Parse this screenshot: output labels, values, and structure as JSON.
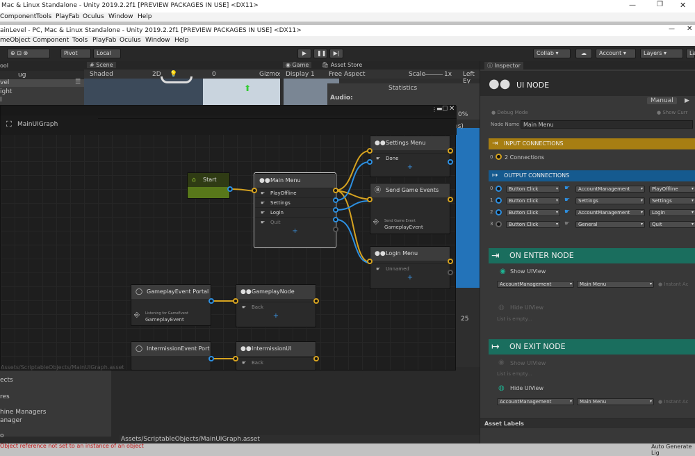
{
  "window": {
    "title": "Mac & Linux Standalone - Unity 2019.2.2f1 [PREVIEW PACKAGES IN USE] <DX11>",
    "menu": [
      "Component",
      "Tools",
      "PlayFab",
      "Oculus",
      "Window",
      "Help"
    ]
  },
  "inner_window": {
    "title": "ainLevel - PC, Mac & Linux Standalone - Unity 2019.2.2f1 [PREVIEW PACKAGES IN USE] <DX11>",
    "menu": [
      "meObject",
      "Component",
      "Tools",
      "PlayFab",
      "Oculus",
      "Window",
      "Help"
    ]
  },
  "toolbar": {
    "pivot": "Pivot",
    "local": "Local",
    "collab": "Collab ▾",
    "account": "Account",
    "layers": "Layers",
    "layout": "La"
  },
  "left_panel": {
    "tab": "ool",
    "search": "ug",
    "items": [
      "vel",
      "ight",
      "l"
    ]
  },
  "scene": {
    "tab": "Scene",
    "shading": "Shaded",
    "mode2d": "2D",
    "count": "0",
    "gizmos": "Gizmos"
  },
  "game": {
    "tab_game": "Game",
    "tab_store": "Asset Store",
    "display": "Display 1",
    "aspect": "Free Aspect",
    "scale_label": "Scale",
    "scale_value": "1x",
    "left_label": "Left Ey",
    "stats_title": "Statistics",
    "audio": "Audio:",
    "pct": "0%",
    "ns": "ns)",
    "count25": "25"
  },
  "graph": {
    "title": "MainUIGraph",
    "path": "Assets/ScriptableObjects/MainUIGraph.asset",
    "nodes": {
      "start": {
        "title": "Start"
      },
      "main_menu": {
        "title": "Main Menu",
        "rows": [
          "PlayOffline",
          "Settings",
          "Login",
          "Quit"
        ]
      },
      "settings_menu": {
        "title": "Settings Menu",
        "rows": [
          "Done"
        ]
      },
      "send_event": {
        "title": "Send Game Events",
        "sub": "Send Game Event",
        "value": "GameplayEvent"
      },
      "login_menu": {
        "title": "Login Menu",
        "rows": [
          "Unnamed"
        ]
      },
      "gp_portal": {
        "title": "GameplayEvent Portal",
        "sub": "Listening for GameEvent",
        "value": "GameplayEvent"
      },
      "gp_node": {
        "title": "GameplayNode",
        "rows": [
          "Back"
        ]
      },
      "im_portal": {
        "title": "IntermissionEvent Port",
        "sub": "Listening for GameEvent"
      },
      "im_ui": {
        "title": "IntermissionUI",
        "rows": [
          "Back"
        ]
      }
    }
  },
  "bottom": {
    "items": [
      "ects",
      "res",
      "hine Managers",
      "anager",
      "o"
    ],
    "path": "Assets/ScriptableObjects/MainUIGraph.asset",
    "error": "Object reference not set to an instance of an object",
    "auto": "Auto Generate Lig"
  },
  "inspector": {
    "tab": "Inspector",
    "header": "UI NODE",
    "manual": "Manual",
    "debug": "Debug Mode",
    "show": "Show Curr",
    "node_name_label": "Node Name",
    "node_name": "Main Menu",
    "input_title": "INPUT CONNECTIONS",
    "input_index": "0",
    "input_count": "2 Connections",
    "output_title": "OUTPUT CONNECTIONS",
    "outputs": [
      {
        "i": "0",
        "trigger": "Button Click",
        "category": "AccountManagement",
        "name": "PlayOffline"
      },
      {
        "i": "1",
        "trigger": "Button Click",
        "category": "Settings",
        "name": "Settings"
      },
      {
        "i": "2",
        "trigger": "Button Click",
        "category": "AccountManagement",
        "name": "Login"
      },
      {
        "i": "3",
        "trigger": "Button Click",
        "category": "General",
        "name": "Quit"
      }
    ],
    "enter_title": "ON ENTER NODE",
    "enter_show": "Show UIView",
    "enter_cat": "AccountManagement",
    "enter_name": "Main Menu",
    "instant": "Instant Ac",
    "enter_hide": "Hide UIView",
    "empty": "List is empty...",
    "exit_title": "ON EXIT NODE",
    "exit_show": "Show UIView",
    "exit_hide": "Hide UIView",
    "exit_cat": "AccountManagement",
    "exit_name": "Main Menu",
    "asset_labels": "Asset Labels"
  },
  "colors": {
    "yellow": "#d6a320",
    "blue": "#2d8fe0",
    "teal": "#1a7a6a",
    "start_green": "#5a7a1a"
  }
}
